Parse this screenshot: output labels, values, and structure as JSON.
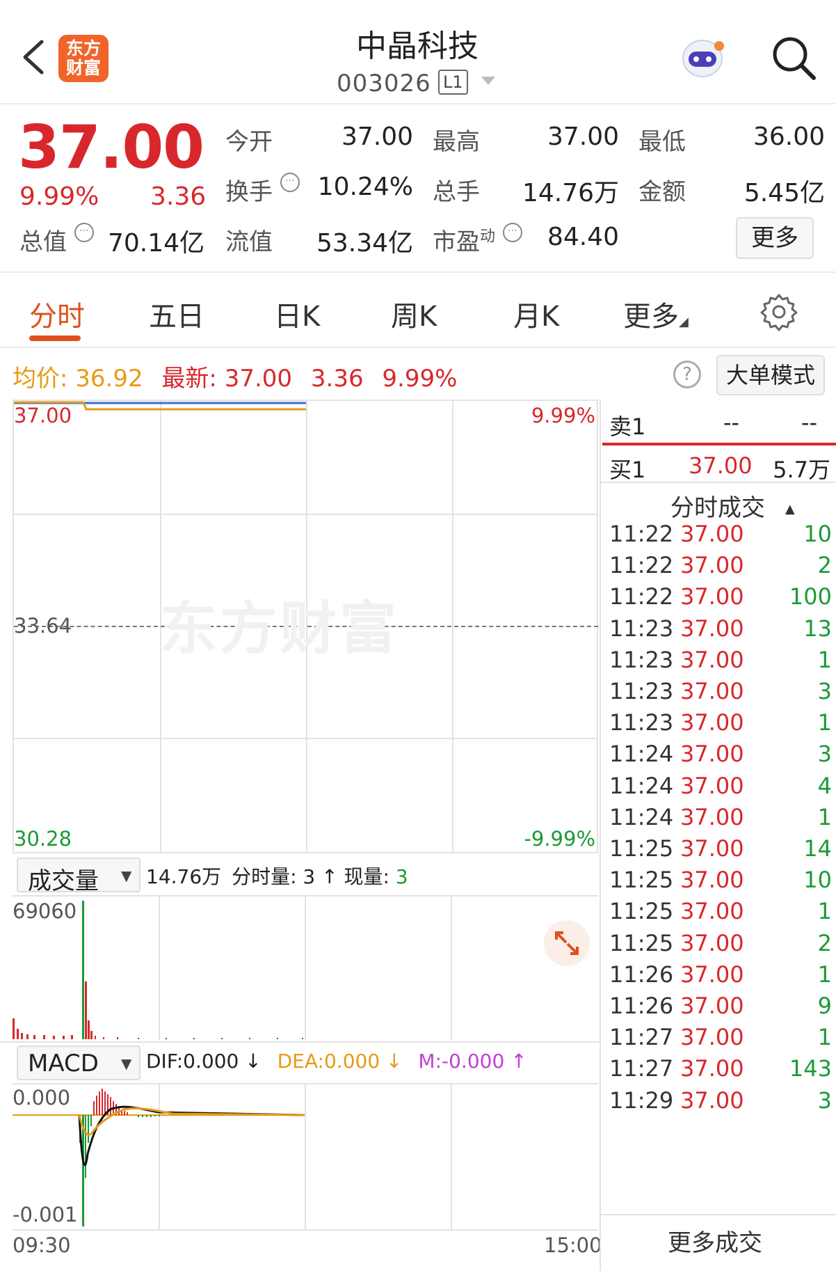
{
  "header": {
    "brand_logo_text": "东方财富",
    "title": "中晶科技",
    "code": "003026",
    "level": "L1"
  },
  "quote": {
    "price": "37.00",
    "change_pct": "9.99%",
    "change": "3.36",
    "open_label": "今开",
    "open": "37.00",
    "high_label": "最高",
    "high": "37.00",
    "low_label": "最低",
    "low": "36.00",
    "turnover_label": "换手",
    "turnover": "10.24%",
    "volume_label": "总手",
    "volume": "14.76万",
    "amount_label": "金额",
    "amount": "5.45亿",
    "total_mv_label": "总值",
    "total_mv": "70.14亿",
    "float_mv_label": "流值",
    "float_mv": "53.34亿",
    "pe_label": "市盈",
    "pe_sup": "动",
    "pe": "84.40",
    "more_label": "更多"
  },
  "tabs": [
    {
      "label": "分时",
      "active": true
    },
    {
      "label": "五日",
      "active": false
    },
    {
      "label": "日K",
      "active": false
    },
    {
      "label": "周K",
      "active": false
    },
    {
      "label": "月K",
      "active": false
    },
    {
      "label": "更多",
      "active": false
    }
  ],
  "avg_row": {
    "avg_label": "均价:",
    "avg_value": "36.92",
    "latest_label": "最新:",
    "latest_value": "37.00",
    "latest_change": "3.36",
    "latest_pct": "9.99%",
    "big_order_label": "大单模式"
  },
  "price_chart": {
    "top_price": "37.00",
    "top_pct": "9.99%",
    "mid_price": "33.64",
    "bottom_price": "30.28",
    "bottom_pct": "-9.99%",
    "watermark": "东方财富"
  },
  "volume_panel": {
    "selector_label": "成交量",
    "total": "14.76万",
    "minute_vol_label": "分时量:",
    "minute_vol": "3",
    "current_vol_label": "现量:",
    "current_vol": "3",
    "max_label": "69060"
  },
  "macd_panel": {
    "selector_label": "MACD",
    "dif": "DIF:0.000",
    "dea": "DEA:0.000",
    "m": "M:-0.000",
    "top_label": "0.000",
    "bottom_label": "-0.001"
  },
  "time_axis": {
    "start": "09:30",
    "end": "15:00"
  },
  "order_book": {
    "sell1_label": "卖1",
    "sell1_price": "--",
    "sell1_vol": "--",
    "buy1_label": "买1",
    "buy1_price": "37.00",
    "buy1_vol": "5.7万"
  },
  "ticks_header": "分时成交",
  "ticks": [
    {
      "time": "11:22",
      "price": "37.00",
      "vol": "10"
    },
    {
      "time": "11:22",
      "price": "37.00",
      "vol": "2"
    },
    {
      "time": "11:22",
      "price": "37.00",
      "vol": "100"
    },
    {
      "time": "11:23",
      "price": "37.00",
      "vol": "13"
    },
    {
      "time": "11:23",
      "price": "37.00",
      "vol": "1"
    },
    {
      "time": "11:23",
      "price": "37.00",
      "vol": "3"
    },
    {
      "time": "11:23",
      "price": "37.00",
      "vol": "1"
    },
    {
      "time": "11:24",
      "price": "37.00",
      "vol": "3"
    },
    {
      "time": "11:24",
      "price": "37.00",
      "vol": "4"
    },
    {
      "time": "11:24",
      "price": "37.00",
      "vol": "1"
    },
    {
      "time": "11:25",
      "price": "37.00",
      "vol": "14"
    },
    {
      "time": "11:25",
      "price": "37.00",
      "vol": "10"
    },
    {
      "time": "11:25",
      "price": "37.00",
      "vol": "1"
    },
    {
      "time": "11:25",
      "price": "37.00",
      "vol": "2"
    },
    {
      "time": "11:26",
      "price": "37.00",
      "vol": "1"
    },
    {
      "time": "11:26",
      "price": "37.00",
      "vol": "9"
    },
    {
      "time": "11:27",
      "price": "37.00",
      "vol": "1"
    },
    {
      "time": "11:27",
      "price": "37.00",
      "vol": "143"
    },
    {
      "time": "11:29",
      "price": "37.00",
      "vol": "3"
    }
  ],
  "more_trades_label": "更多成交",
  "colors": {
    "up": "#d8272c",
    "down": "#1a9b35",
    "accent": "#e0501e",
    "avg": "#e69b16",
    "macd_m": "#c23fd6"
  }
}
